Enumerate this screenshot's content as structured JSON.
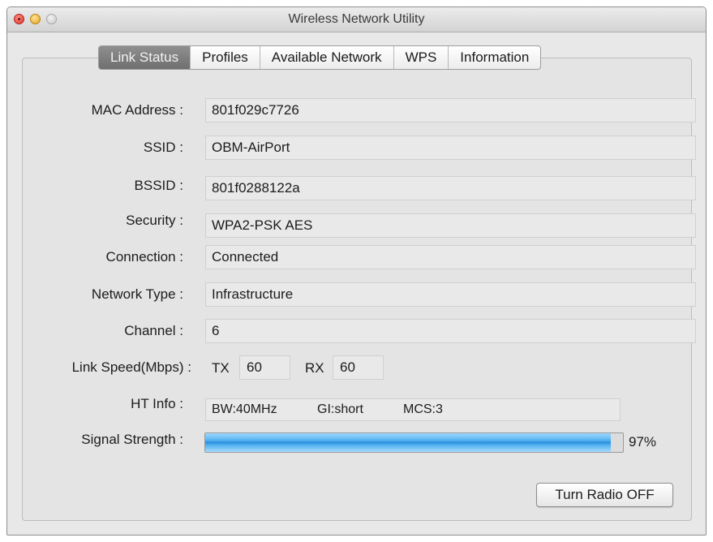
{
  "window": {
    "title": "Wireless Network Utility"
  },
  "tabs": [
    {
      "label": "Link Status",
      "active": true
    },
    {
      "label": "Profiles",
      "active": false
    },
    {
      "label": "Available Network",
      "active": false
    },
    {
      "label": "WPS",
      "active": false
    },
    {
      "label": "Information",
      "active": false
    }
  ],
  "fields": {
    "mac_address": {
      "label": "MAC Address :",
      "value": "801f029c7726"
    },
    "ssid": {
      "label": "SSID :",
      "value": "OBM-AirPort"
    },
    "bssid": {
      "label": "BSSID :",
      "value": "801f0288122a"
    },
    "security": {
      "label": "Security :",
      "value": "WPA2-PSK AES"
    },
    "connection": {
      "label": "Connection :",
      "value": "Connected"
    },
    "network_type": {
      "label": "Network Type :",
      "value": "Infrastructure"
    },
    "channel": {
      "label": "Channel :",
      "value": "6"
    }
  },
  "link_speed": {
    "label": "Link Speed(Mbps) :",
    "tx_label": "TX",
    "tx_value": "60",
    "rx_label": "RX",
    "rx_value": "60"
  },
  "ht_info": {
    "label": "HT Info :",
    "bw": "BW:40MHz",
    "gi": "GI:short",
    "mcs": "MCS:3"
  },
  "signal": {
    "label": "Signal Strength :",
    "percent": 97,
    "percent_text": "97%",
    "bar_color": "#2c8fe0"
  },
  "buttons": {
    "radio": "Turn Radio OFF"
  }
}
